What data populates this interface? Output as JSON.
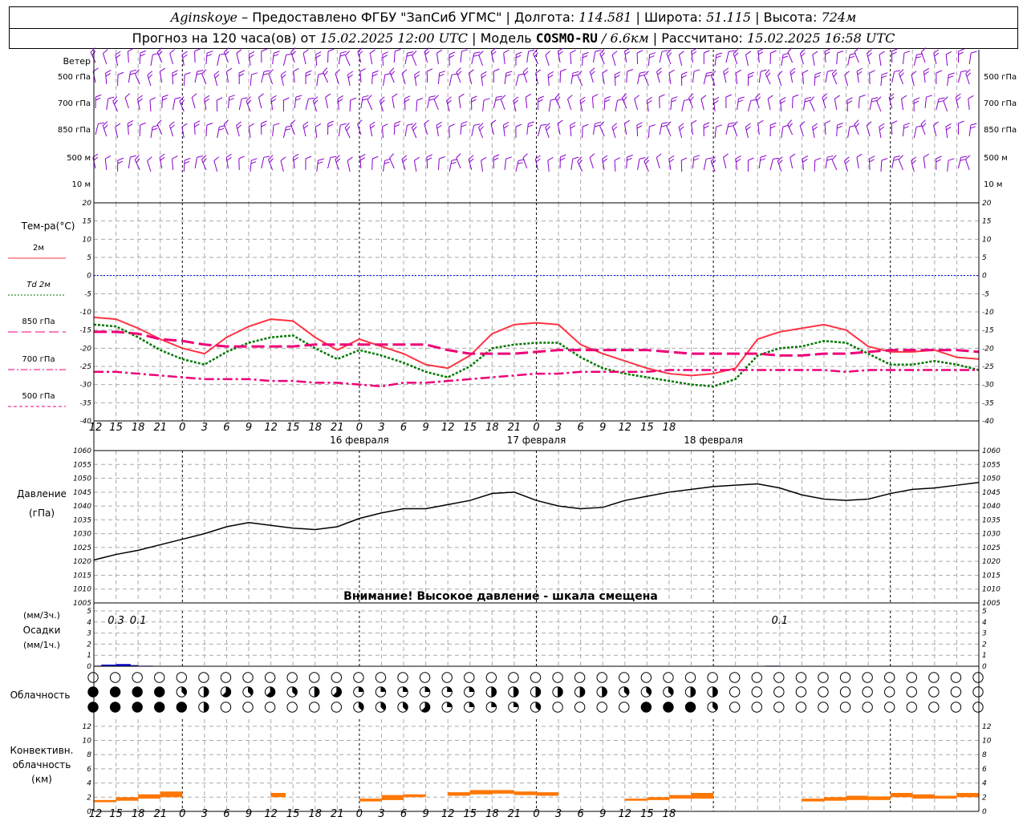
{
  "header": {
    "station": "Aginskoye",
    "provider": " – Предоставлено ФГБУ \"ЗапСиб УГМС\" | Долгота: ",
    "lon": "114.581",
    "lat_label": " | Широта: ",
    "lat": "51.115",
    "alt_label": " | Высота: ",
    "alt": "724м",
    "forecast_label": "Прогноз на 120 часа(ов) от ",
    "forecast_from": "15.02.2025 12:00 UTC",
    "model_label": "  | Модель ",
    "model": "COSMO-RU",
    "resolution": " / 6.6км",
    "computed_label": " | Рассчитано: ",
    "computed": "15.02.2025 16:58 UTC"
  },
  "colors": {
    "wind": "#8800cc",
    "t2m": "#ff3344",
    "td2m": "#007700",
    "t850": "#ee0077",
    "t700": "#ee0077",
    "t500": "#ee0077",
    "zero": "#0000ff",
    "pressure": "#000000",
    "precip": "#0000cc",
    "conv": "#ff7700",
    "grid": "#999999"
  },
  "wind_panel": {
    "title": "Ветер",
    "levels": [
      "500 гПа",
      "700 гПа",
      "850 гПа",
      "500 м",
      "10  м"
    ]
  },
  "temp_panel": {
    "title": "Тем-ра(°C)",
    "legend": [
      {
        "label": "2м",
        "style": "solid"
      },
      {
        "label": "Td  2м",
        "style": "dotted"
      },
      {
        "label": "850 гПа",
        "style": "long-dash"
      },
      {
        "label": "700 гПа",
        "style": "dash-dot"
      },
      {
        "label": "500 гПа",
        "style": "dashed"
      }
    ]
  },
  "pressure_panel": {
    "title": "Давление",
    "unit": "(гПа)",
    "warning": "Внимание! Высокое давление - шкала смещена"
  },
  "precip_panel": {
    "unit3": "(мм/3ч.)",
    "title": "Осадки",
    "unit1": "(мм/1ч.)",
    "labels": [
      {
        "hour": 3,
        "text": "0.3"
      },
      {
        "hour": 6,
        "text": "0.1"
      },
      {
        "hour": 93,
        "text": "0.1"
      }
    ]
  },
  "cloud_panel": {
    "title": "Облачность"
  },
  "conv_panel": {
    "lines": [
      "Конвективн.",
      "облачность",
      "(км)"
    ]
  },
  "chart_data": [
    {
      "type": "line",
      "title": "Тем-ра(°C)",
      "ylim": [
        -40,
        20
      ],
      "y_ticks": [
        20,
        15,
        10,
        5,
        0,
        -5,
        -10,
        -15,
        -20,
        -25,
        -30,
        -35,
        -40
      ],
      "x_hours": [
        0,
        3,
        6,
        9,
        12,
        15,
        18,
        21,
        24,
        27,
        30,
        33,
        36,
        39,
        42,
        45,
        48,
        51,
        54,
        57,
        60,
        63,
        66,
        69,
        72,
        75,
        78,
        81,
        84,
        87,
        90,
        93,
        96,
        99,
        102,
        105,
        108,
        111,
        114,
        117,
        120
      ],
      "x_tick_labels": [
        "12",
        "15",
        "18",
        "21",
        "0",
        "3",
        "6",
        "9",
        "12",
        "15",
        "18",
        "21",
        "0",
        "3",
        "6",
        "9",
        "12",
        "15",
        "18",
        "21",
        "0",
        "3",
        "6",
        "9",
        "12",
        "15",
        "18"
      ],
      "date_labels": [
        {
          "hour": 36,
          "text": "16 февраля"
        },
        {
          "hour": 60,
          "text": "17 февраля"
        },
        {
          "hour": 84,
          "text": "18 февраля"
        }
      ],
      "series": [
        {
          "name": "2м",
          "values": [
            -11.5,
            -12,
            -14.5,
            -17.5,
            -20,
            -21.5,
            -17,
            -14,
            -12,
            -12.5,
            -17,
            -20.5,
            -17.5,
            -19.5,
            -21.5,
            -24.5,
            -25.5,
            -22,
            -16,
            -13.5,
            -13,
            -13.5,
            -19,
            -21.5,
            -23.5,
            -25.5,
            -27,
            -27.5,
            -27,
            -25.5,
            -17.5,
            -15.5,
            -14.5,
            -13.5,
            -15,
            -19.5,
            -21,
            -21,
            -20.5,
            -22.5,
            -23
          ]
        },
        {
          "name": "Td 2м",
          "values": [
            -13.5,
            -14,
            -17,
            -20.5,
            -23,
            -24.5,
            -21,
            -18.5,
            -17,
            -16.5,
            -20,
            -23,
            -20.5,
            -22,
            -24,
            -26.5,
            -28,
            -25,
            -20,
            -19,
            -18.5,
            -18.5,
            -22.5,
            -25.5,
            -27,
            -28,
            -29,
            -30,
            -30.5,
            -28.5,
            -22,
            -20,
            -19.5,
            -18,
            -18.5,
            -21.5,
            -24.5,
            -24.5,
            -23.5,
            -24.5,
            -26
          ]
        },
        {
          "name": "850 гПа",
          "values": [
            -15.5,
            -15.5,
            -16,
            -17.5,
            -18,
            -19,
            -19.5,
            -19.5,
            -19.5,
            -19.5,
            -19,
            -19,
            -19,
            -19,
            -19,
            -19,
            -20.5,
            -21.5,
            -21.5,
            -21.5,
            -21,
            -20.5,
            -20.5,
            -20.5,
            -20.5,
            -20.5,
            -21,
            -21.5,
            -21.5,
            -21.5,
            -21.5,
            -22,
            -22,
            -21.5,
            -21.5,
            -21,
            -20.5,
            -20.5,
            -20.5,
            -20.5,
            -21
          ]
        },
        {
          "name": "700 гПа",
          "values": [
            -26.5,
            -26.5,
            -27,
            -27.5,
            -28,
            -28.5,
            -28.5,
            -28.5,
            -29,
            -29,
            -29.5,
            -29.5,
            -30,
            -30.5,
            -29.5,
            -29.5,
            -29,
            -28.5,
            -28,
            -27.5,
            -27,
            -27,
            -26.5,
            -26.5,
            -26.5,
            -26.5,
            -26,
            -26,
            -26,
            -26,
            -26,
            -26,
            -26,
            -26,
            -26.5,
            -26,
            -26,
            -26,
            -26,
            -26,
            -26
          ]
        }
      ]
    },
    {
      "type": "line",
      "title": "Давление",
      "ylabel": "(гПа)",
      "ylim": [
        1005,
        1060
      ],
      "y_ticks": [
        1060,
        1055,
        1050,
        1045,
        1040,
        1035,
        1030,
        1025,
        1020,
        1015,
        1010,
        1005
      ],
      "series": [
        {
          "name": "Давление",
          "values": [
            1020.5,
            1022.5,
            1024,
            1026,
            1028,
            1030,
            1032.5,
            1034,
            1033,
            1032,
            1031.5,
            1032.5,
            1035.5,
            1037.5,
            1039,
            1039,
            1040.5,
            1042,
            1044.5,
            1045,
            1042,
            1040,
            1039,
            1039.5,
            1042,
            1043.5,
            1045,
            1046,
            1047,
            1047.5,
            1048,
            1046.5,
            1044,
            1042.5,
            1042,
            1042.5,
            1044.5,
            1046,
            1046.5,
            1047.5,
            1048.5
          ]
        }
      ]
    },
    {
      "type": "bar",
      "title": "Осадки",
      "ylabel": "(мм/1ч.)",
      "ylim": [
        0,
        5
      ],
      "y_ticks": [
        5,
        4,
        3,
        2,
        1,
        0
      ],
      "bars": [
        {
          "from": 0,
          "to": 1,
          "value": 0.05
        },
        {
          "from": 1,
          "to": 3,
          "value": 0.15
        },
        {
          "from": 3,
          "to": 5,
          "value": 0.2
        },
        {
          "from": 5,
          "to": 6,
          "value": 0.1
        },
        {
          "from": 6,
          "to": 8,
          "value": 0.05
        },
        {
          "from": 91,
          "to": 93,
          "value": 0.05
        },
        {
          "from": 93,
          "to": 94,
          "value": 0.03
        }
      ]
    },
    {
      "type": "table",
      "title": "Облачность",
      "note": "cloud cover eighths per 3 h, three rows (top/middle/bottom)",
      "rows": [
        [
          0,
          0,
          0,
          0,
          0,
          0,
          0,
          0,
          0,
          0,
          0,
          0,
          0,
          0,
          0,
          0,
          0,
          0,
          0,
          0,
          0,
          0,
          0,
          0,
          0,
          0,
          0,
          0,
          0,
          0,
          0,
          0,
          0,
          0,
          0,
          0,
          0,
          0,
          0,
          0,
          0
        ],
        [
          8,
          8,
          8,
          8,
          3,
          4,
          5,
          3,
          5,
          3,
          4,
          5,
          2,
          2,
          2,
          2,
          2,
          2,
          4,
          4,
          4,
          4,
          4,
          4,
          3,
          3,
          3,
          4,
          4,
          0,
          0,
          0,
          0,
          0,
          0,
          0,
          0,
          0,
          0,
          0,
          0
        ],
        [
          8,
          8,
          8,
          8,
          8,
          4,
          0,
          0,
          0,
          0,
          0,
          0,
          3,
          3,
          3,
          5,
          2,
          2,
          2,
          2,
          3,
          0,
          0,
          0,
          0,
          8,
          8,
          8,
          3,
          0,
          0,
          0,
          0,
          0,
          0,
          0,
          0,
          0,
          0,
          0,
          0
        ]
      ]
    },
    {
      "type": "bar",
      "title": "Конвективн. облачность (км)",
      "ylim": [
        0,
        13
      ],
      "y_ticks": [
        12,
        10,
        8,
        6,
        4,
        2,
        0
      ],
      "bars": [
        {
          "from": 0,
          "to": 3,
          "bottom": 1.3,
          "top": 1.6
        },
        {
          "from": 3,
          "to": 6,
          "bottom": 1.5,
          "top": 2.0
        },
        {
          "from": 6,
          "to": 9,
          "bottom": 1.8,
          "top": 2.4
        },
        {
          "from": 9,
          "to": 12,
          "bottom": 2.0,
          "top": 2.8
        },
        {
          "from": 24,
          "to": 26,
          "bottom": 2.0,
          "top": 2.6
        },
        {
          "from": 36,
          "to": 39,
          "bottom": 1.4,
          "top": 1.8
        },
        {
          "from": 39,
          "to": 42,
          "bottom": 1.6,
          "top": 2.3
        },
        {
          "from": 42,
          "to": 45,
          "bottom": 2.0,
          "top": 2.4
        },
        {
          "from": 48,
          "to": 51,
          "bottom": 2.2,
          "top": 2.7
        },
        {
          "from": 51,
          "to": 54,
          "bottom": 2.4,
          "top": 3.0
        },
        {
          "from": 54,
          "to": 57,
          "bottom": 2.5,
          "top": 3.0
        },
        {
          "from": 57,
          "to": 60,
          "bottom": 2.3,
          "top": 2.8
        },
        {
          "from": 60,
          "to": 63,
          "bottom": 2.2,
          "top": 2.7
        },
        {
          "from": 72,
          "to": 75,
          "bottom": 1.5,
          "top": 1.8
        },
        {
          "from": 75,
          "to": 78,
          "bottom": 1.6,
          "top": 2.0
        },
        {
          "from": 78,
          "to": 81,
          "bottom": 1.8,
          "top": 2.3
        },
        {
          "from": 81,
          "to": 84,
          "bottom": 1.8,
          "top": 2.6
        },
        {
          "from": 96,
          "to": 99,
          "bottom": 1.4,
          "top": 1.8
        },
        {
          "from": 99,
          "to": 102,
          "bottom": 1.5,
          "top": 2.0
        },
        {
          "from": 102,
          "to": 105,
          "bottom": 1.6,
          "top": 2.2
        },
        {
          "from": 105,
          "to": 108,
          "bottom": 1.6,
          "top": 2.1
        },
        {
          "from": 108,
          "to": 111,
          "bottom": 2.0,
          "top": 2.6
        },
        {
          "from": 111,
          "to": 114,
          "bottom": 1.8,
          "top": 2.4
        },
        {
          "from": 114,
          "to": 117,
          "bottom": 1.8,
          "top": 2.2
        },
        {
          "from": 117,
          "to": 120,
          "bottom": 2.0,
          "top": 2.6
        }
      ]
    }
  ]
}
